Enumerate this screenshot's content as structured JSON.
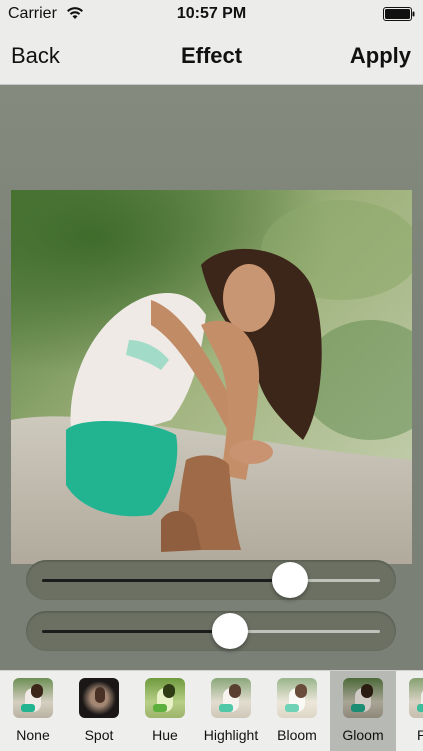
{
  "status_bar": {
    "carrier": "Carrier",
    "time": "10:57 PM"
  },
  "nav": {
    "back_label": "Back",
    "title": "Effect",
    "apply_label": "Apply"
  },
  "photo": {
    "subject": "young woman sitting on sand hugging her knees"
  },
  "sliders": [
    {
      "name": "effect-slider-1",
      "value": 0.73
    },
    {
      "name": "effect-slider-2",
      "value": 0.54
    }
  ],
  "filters": {
    "selected": "Gloom",
    "items": [
      {
        "label": "None",
        "tone": "#c9c1a8"
      },
      {
        "label": "Spot",
        "tone": "#2a2624"
      },
      {
        "label": "Hue",
        "tone": "#a5c27a"
      },
      {
        "label": "Highlight",
        "tone": "#d9d2bf"
      },
      {
        "label": "Bloom",
        "tone": "#e3dcc8"
      },
      {
        "label": "Gloom",
        "tone": "#8d9474"
      },
      {
        "label": "Pos",
        "tone": "#cfc8b4"
      }
    ]
  },
  "colors": {
    "workspace": "#7c8277",
    "bar": "#ecedeb",
    "slider_track": "#6b7063",
    "selected_filter": "#b7b9b4"
  }
}
